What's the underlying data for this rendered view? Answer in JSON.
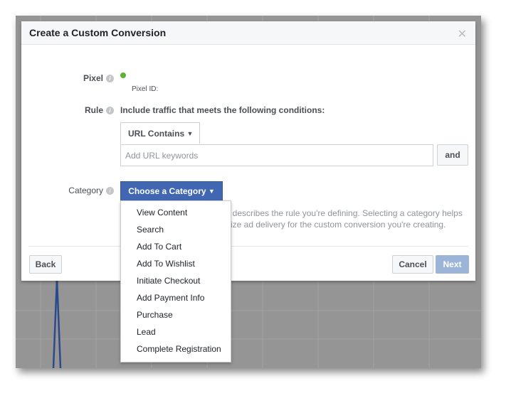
{
  "dialog": {
    "title": "Create a Custom Conversion",
    "close_icon": "close-icon"
  },
  "pixel": {
    "label": "Pixel",
    "status_color": "#5cb335",
    "pixel_id_label": "Pixel ID:"
  },
  "rule": {
    "label": "Rule",
    "description": "Include traffic that meets the following conditions:",
    "condition_select": "URL Contains",
    "keywords_placeholder": "Add URL keywords",
    "and_button": "and"
  },
  "category": {
    "label": "Category",
    "button": "Choose a Category",
    "help_line1": "t describes the rule you're defining. Selecting a category helps",
    "help_line2": "ize ad delivery for the custom conversion you're creating.",
    "options": [
      "View Content",
      "Search",
      "Add To Cart",
      "Add To Wishlist",
      "Initiate Checkout",
      "Add Payment Info",
      "Purchase",
      "Lead",
      "Complete Registration"
    ]
  },
  "footer": {
    "back": "Back",
    "cancel": "Cancel",
    "next": "Next"
  },
  "colors": {
    "primary": "#4267b2",
    "next_disabled": "#9cb4d8"
  }
}
